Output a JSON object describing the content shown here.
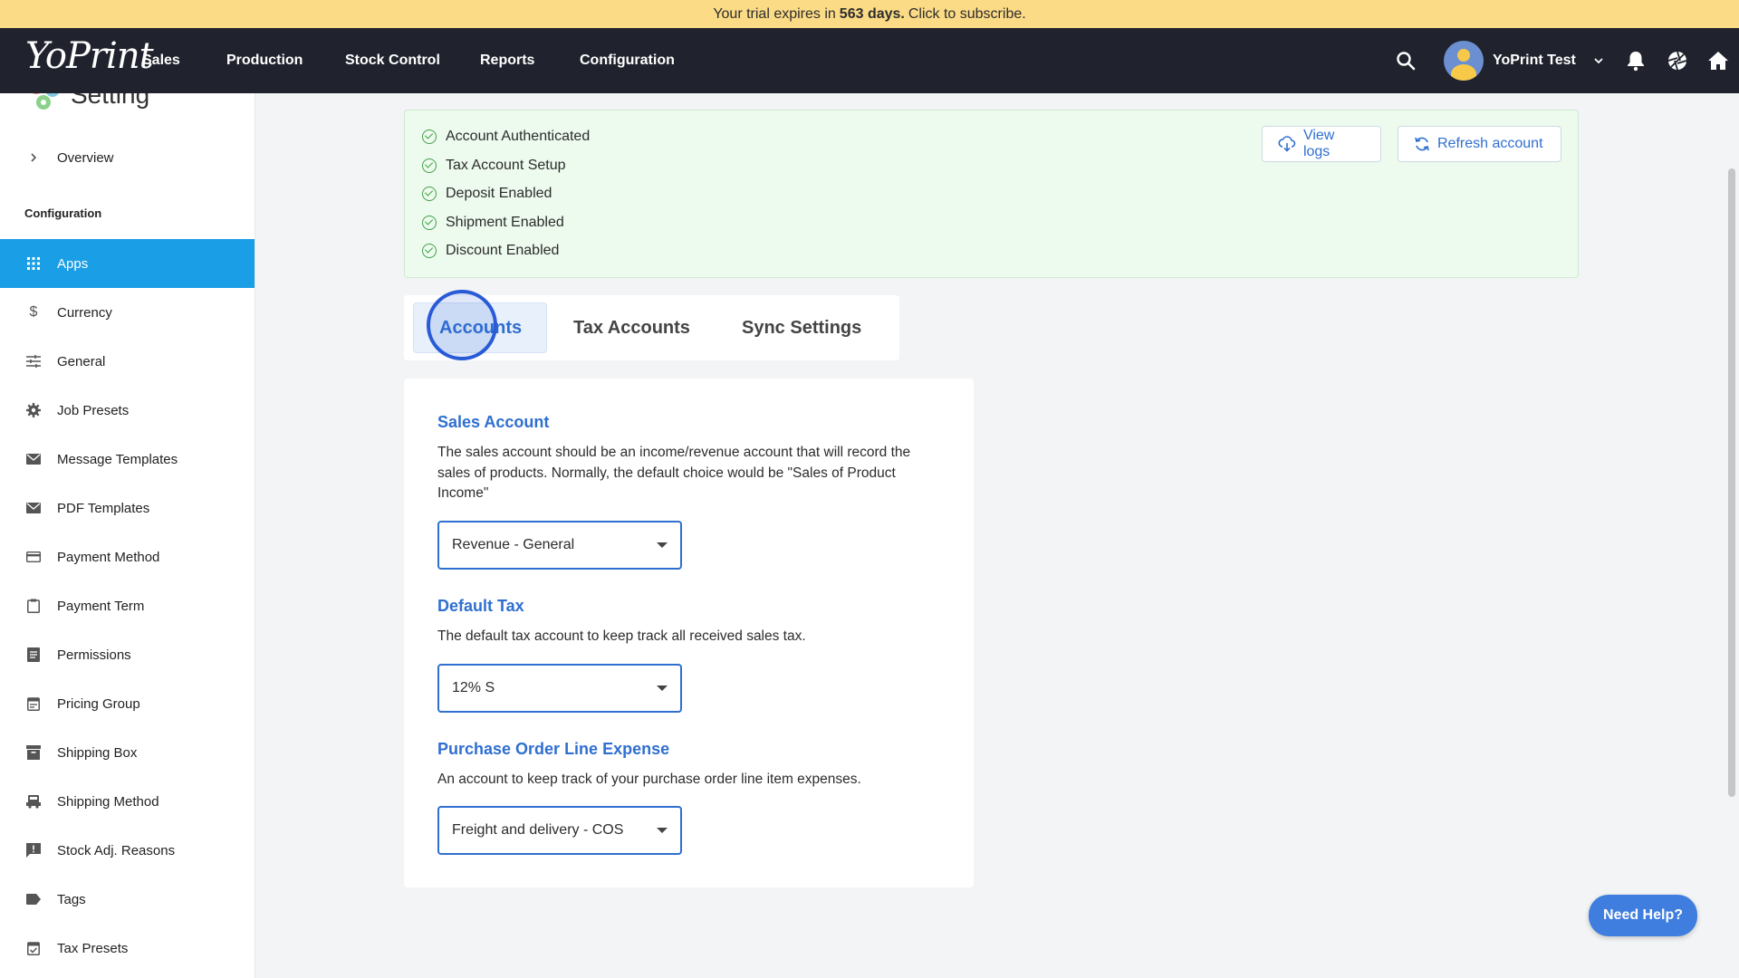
{
  "banner": {
    "prefix": "Your trial expires in",
    "days": "563 days.",
    "suffix": "Click to subscribe."
  },
  "nav": {
    "logo": "YoPrint",
    "items": [
      "Sales",
      "Production",
      "Stock Control",
      "Reports",
      "Configuration"
    ],
    "user_name": "YoPrint Test"
  },
  "sidebar": {
    "title": "Setting",
    "overview": "Overview",
    "section": "Configuration",
    "items": [
      {
        "label": "Apps",
        "icon": "apps-grid-icon"
      },
      {
        "label": "Currency",
        "icon": "dollar-icon"
      },
      {
        "label": "General",
        "icon": "sliders-icon"
      },
      {
        "label": "Job Presets",
        "icon": "gear-icon"
      },
      {
        "label": "Message Templates",
        "icon": "mail-icon"
      },
      {
        "label": "PDF Templates",
        "icon": "mail-icon"
      },
      {
        "label": "Payment Method",
        "icon": "credit-card-icon"
      },
      {
        "label": "Payment Term",
        "icon": "clipboard-icon"
      },
      {
        "label": "Permissions",
        "icon": "document-icon"
      },
      {
        "label": "Pricing Group",
        "icon": "calendar-icon"
      },
      {
        "label": "Shipping Box",
        "icon": "archive-box-icon"
      },
      {
        "label": "Shipping Method",
        "icon": "truck-icon"
      },
      {
        "label": "Stock Adj. Reasons",
        "icon": "alert-message-icon"
      },
      {
        "label": "Tags",
        "icon": "tag-icon"
      },
      {
        "label": "Tax Presets",
        "icon": "calendar-check-icon"
      }
    ],
    "active": "Apps"
  },
  "status": {
    "items": [
      "Account Authenticated",
      "Tax Account Setup",
      "Deposit Enabled",
      "Shipment Enabled",
      "Discount Enabled"
    ],
    "view_logs": "View logs",
    "refresh": "Refresh account"
  },
  "tabs": [
    "Accounts",
    "Tax Accounts",
    "Sync Settings"
  ],
  "active_tab": "Accounts",
  "form": {
    "sales_account": {
      "title": "Sales Account",
      "desc": "The sales account should be an income/revenue account that will record the sales of products. Normally, the default choice would be \"Sales of Product Income\"",
      "value": "Revenue - General"
    },
    "default_tax": {
      "title": "Default Tax",
      "desc": "The default tax account to keep track all received sales tax.",
      "value": "12% S"
    },
    "po_line_expense": {
      "title": "Purchase Order Line Expense",
      "desc": "An account to keep track of your purchase order line item expenses.",
      "value": "Freight and delivery - COS"
    }
  },
  "help": "Need Help?"
}
